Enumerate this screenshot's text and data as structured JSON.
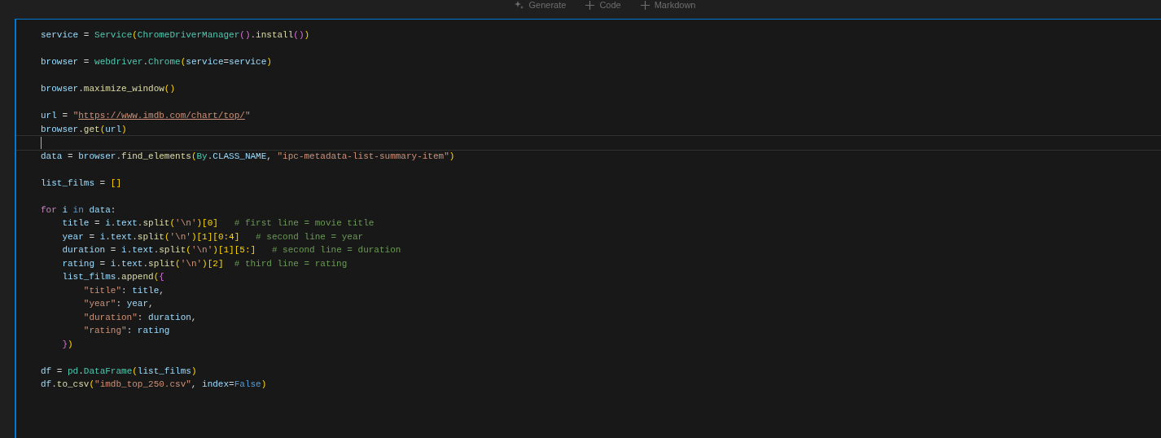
{
  "toolbar": {
    "buttons": [
      {
        "kind": "sparkle",
        "label": "Generate"
      },
      {
        "kind": "plus",
        "label": "Code"
      },
      {
        "kind": "plus",
        "label": "Markdown"
      }
    ]
  },
  "cell": {
    "lines": [
      {
        "kind": "code",
        "tokens": [
          {
            "kind": "var",
            "text": "service"
          },
          {
            "kind": "op",
            "text": " = "
          },
          {
            "kind": "class",
            "text": "Service"
          },
          {
            "kind": "b1",
            "text": "("
          },
          {
            "kind": "class",
            "text": "ChromeDriverManager"
          },
          {
            "kind": "b2",
            "text": "()"
          },
          {
            "kind": "op",
            "text": "."
          },
          {
            "kind": "func",
            "text": "install"
          },
          {
            "kind": "b2",
            "text": "()"
          },
          {
            "kind": "b1",
            "text": ")"
          }
        ]
      },
      {
        "kind": "blank"
      },
      {
        "kind": "code",
        "tokens": [
          {
            "kind": "var",
            "text": "browser"
          },
          {
            "kind": "op",
            "text": " = "
          },
          {
            "kind": "class",
            "text": "webdriver"
          },
          {
            "kind": "op",
            "text": "."
          },
          {
            "kind": "class",
            "text": "Chrome"
          },
          {
            "kind": "b1",
            "text": "("
          },
          {
            "kind": "var",
            "text": "service"
          },
          {
            "kind": "op",
            "text": "="
          },
          {
            "kind": "var",
            "text": "service"
          },
          {
            "kind": "b1",
            "text": ")"
          }
        ]
      },
      {
        "kind": "blank"
      },
      {
        "kind": "code",
        "tokens": [
          {
            "kind": "var",
            "text": "browser"
          },
          {
            "kind": "op",
            "text": "."
          },
          {
            "kind": "func",
            "text": "maximize_window"
          },
          {
            "kind": "b1",
            "text": "()"
          }
        ]
      },
      {
        "kind": "blank"
      },
      {
        "kind": "code",
        "tokens": [
          {
            "kind": "var",
            "text": "url"
          },
          {
            "kind": "op",
            "text": " = "
          },
          {
            "kind": "string",
            "text": "\""
          },
          {
            "kind": "link",
            "text": "https://www.imdb.com/chart/top/"
          },
          {
            "kind": "string",
            "text": "\""
          }
        ]
      },
      {
        "kind": "code",
        "tokens": [
          {
            "kind": "var",
            "text": "browser"
          },
          {
            "kind": "op",
            "text": "."
          },
          {
            "kind": "func",
            "text": "get"
          },
          {
            "kind": "b1",
            "text": "("
          },
          {
            "kind": "var",
            "text": "url"
          },
          {
            "kind": "b1",
            "text": ")"
          }
        ]
      },
      {
        "kind": "cursor"
      },
      {
        "kind": "code",
        "tokens": [
          {
            "kind": "var",
            "text": "data"
          },
          {
            "kind": "op",
            "text": " = "
          },
          {
            "kind": "var",
            "text": "browser"
          },
          {
            "kind": "op",
            "text": "."
          },
          {
            "kind": "func",
            "text": "find_elements"
          },
          {
            "kind": "b1",
            "text": "("
          },
          {
            "kind": "class",
            "text": "By"
          },
          {
            "kind": "op",
            "text": "."
          },
          {
            "kind": "var",
            "text": "CLASS_NAME"
          },
          {
            "kind": "op",
            "text": ", "
          },
          {
            "kind": "string",
            "text": "\"ipc-metadata-list-summary-item\""
          },
          {
            "kind": "b1",
            "text": ")"
          }
        ]
      },
      {
        "kind": "blank"
      },
      {
        "kind": "code",
        "tokens": [
          {
            "kind": "var",
            "text": "list_films"
          },
          {
            "kind": "op",
            "text": " = "
          },
          {
            "kind": "b1",
            "text": "[]"
          }
        ]
      },
      {
        "kind": "blank"
      },
      {
        "kind": "code",
        "tokens": [
          {
            "kind": "keyword",
            "text": "for"
          },
          {
            "kind": "var",
            "text": " i"
          },
          {
            "kind": "constant",
            "text": " in"
          },
          {
            "kind": "var",
            "text": " data"
          },
          {
            "kind": "op",
            "text": ":"
          }
        ]
      },
      {
        "kind": "code",
        "tokens": [
          {
            "kind": "var",
            "text": "    title"
          },
          {
            "kind": "op",
            "text": " = "
          },
          {
            "kind": "var",
            "text": "i"
          },
          {
            "kind": "op",
            "text": "."
          },
          {
            "kind": "var",
            "text": "text"
          },
          {
            "kind": "op",
            "text": "."
          },
          {
            "kind": "func",
            "text": "split"
          },
          {
            "kind": "b1",
            "text": "("
          },
          {
            "kind": "string",
            "text": "'\\n'"
          },
          {
            "kind": "b1",
            "text": ")[0]"
          },
          {
            "kind": "comment",
            "text": "   # first line = movie title"
          }
        ]
      },
      {
        "kind": "code",
        "tokens": [
          {
            "kind": "var",
            "text": "    year"
          },
          {
            "kind": "op",
            "text": " = "
          },
          {
            "kind": "var",
            "text": "i"
          },
          {
            "kind": "op",
            "text": "."
          },
          {
            "kind": "var",
            "text": "text"
          },
          {
            "kind": "op",
            "text": "."
          },
          {
            "kind": "func",
            "text": "split"
          },
          {
            "kind": "b1",
            "text": "("
          },
          {
            "kind": "string",
            "text": "'\\n'"
          },
          {
            "kind": "b1",
            "text": ")[1][0:4]"
          },
          {
            "kind": "comment",
            "text": "   # second line = year"
          }
        ]
      },
      {
        "kind": "code",
        "tokens": [
          {
            "kind": "var",
            "text": "    duration"
          },
          {
            "kind": "op",
            "text": " = "
          },
          {
            "kind": "var",
            "text": "i"
          },
          {
            "kind": "op",
            "text": "."
          },
          {
            "kind": "var",
            "text": "text"
          },
          {
            "kind": "op",
            "text": "."
          },
          {
            "kind": "func",
            "text": "split"
          },
          {
            "kind": "b1",
            "text": "("
          },
          {
            "kind": "string",
            "text": "'\\n'"
          },
          {
            "kind": "b1",
            "text": ")[1][5:]"
          },
          {
            "kind": "comment",
            "text": "   # second line = duration"
          }
        ]
      },
      {
        "kind": "code",
        "tokens": [
          {
            "kind": "var",
            "text": "    rating"
          },
          {
            "kind": "op",
            "text": " = "
          },
          {
            "kind": "var",
            "text": "i"
          },
          {
            "kind": "op",
            "text": "."
          },
          {
            "kind": "var",
            "text": "text"
          },
          {
            "kind": "op",
            "text": "."
          },
          {
            "kind": "func",
            "text": "split"
          },
          {
            "kind": "b1",
            "text": "("
          },
          {
            "kind": "string",
            "text": "'\\n'"
          },
          {
            "kind": "b1",
            "text": ")[2]"
          },
          {
            "kind": "comment",
            "text": "  # third line = rating"
          }
        ]
      },
      {
        "kind": "code",
        "tokens": [
          {
            "kind": "var",
            "text": "    list_films"
          },
          {
            "kind": "op",
            "text": "."
          },
          {
            "kind": "func",
            "text": "append"
          },
          {
            "kind": "b1",
            "text": "("
          },
          {
            "kind": "b2",
            "text": "{"
          }
        ]
      },
      {
        "kind": "code",
        "tokens": [
          {
            "kind": "string",
            "text": "        \"title\""
          },
          {
            "kind": "op",
            "text": ": "
          },
          {
            "kind": "var",
            "text": "title"
          },
          {
            "kind": "op",
            "text": ","
          }
        ]
      },
      {
        "kind": "code",
        "tokens": [
          {
            "kind": "string",
            "text": "        \"year\""
          },
          {
            "kind": "op",
            "text": ": "
          },
          {
            "kind": "var",
            "text": "year"
          },
          {
            "kind": "op",
            "text": ","
          }
        ]
      },
      {
        "kind": "code",
        "tokens": [
          {
            "kind": "string",
            "text": "        \"duration\""
          },
          {
            "kind": "op",
            "text": ": "
          },
          {
            "kind": "var",
            "text": "duration"
          },
          {
            "kind": "op",
            "text": ","
          }
        ]
      },
      {
        "kind": "code",
        "tokens": [
          {
            "kind": "string",
            "text": "        \"rating\""
          },
          {
            "kind": "op",
            "text": ": "
          },
          {
            "kind": "var",
            "text": "rating"
          }
        ]
      },
      {
        "kind": "code",
        "tokens": [
          {
            "kind": "b2",
            "text": "    }"
          },
          {
            "kind": "b1",
            "text": ")"
          }
        ]
      },
      {
        "kind": "blank"
      },
      {
        "kind": "code",
        "tokens": [
          {
            "kind": "var",
            "text": "df"
          },
          {
            "kind": "op",
            "text": " = "
          },
          {
            "kind": "class",
            "text": "pd"
          },
          {
            "kind": "op",
            "text": "."
          },
          {
            "kind": "class",
            "text": "DataFrame"
          },
          {
            "kind": "b1",
            "text": "("
          },
          {
            "kind": "var",
            "text": "list_films"
          },
          {
            "kind": "b1",
            "text": ")"
          }
        ]
      },
      {
        "kind": "code",
        "tokens": [
          {
            "kind": "var",
            "text": "df"
          },
          {
            "kind": "op",
            "text": "."
          },
          {
            "kind": "func",
            "text": "to_csv"
          },
          {
            "kind": "b1",
            "text": "("
          },
          {
            "kind": "string",
            "text": "\"imdb_top_250.csv\""
          },
          {
            "kind": "op",
            "text": ", "
          },
          {
            "kind": "var",
            "text": "index"
          },
          {
            "kind": "op",
            "text": "="
          },
          {
            "kind": "constant",
            "text": "False"
          },
          {
            "kind": "b1",
            "text": ")"
          }
        ]
      }
    ]
  }
}
